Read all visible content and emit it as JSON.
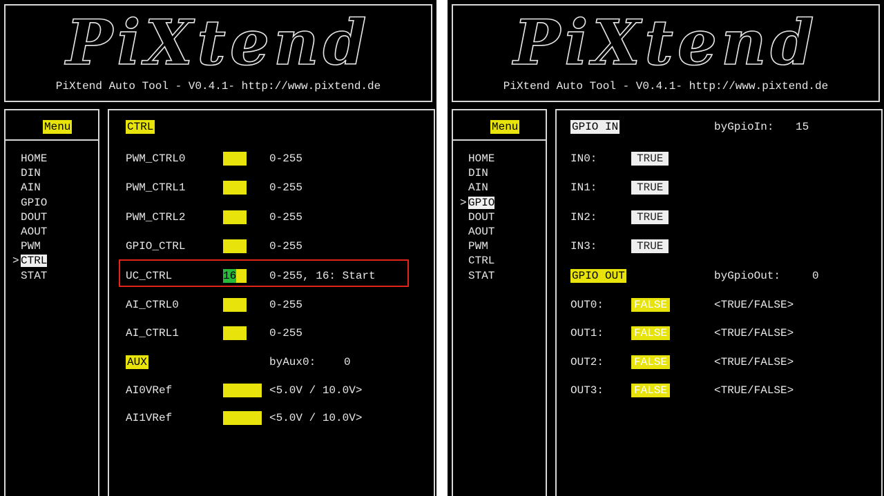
{
  "logo": {
    "text": "PiXtend",
    "subtitle": "PiXtend Auto Tool - V0.4.1- http://www.pixtend.de"
  },
  "menu": {
    "title": "Menu",
    "items": [
      "HOME",
      "DIN",
      "AIN",
      "GPIO",
      "DOUT",
      "AOUT",
      "PWM",
      "CTRL",
      "STAT"
    ],
    "cursor": ">"
  },
  "ctrl": {
    "title": "CTRL",
    "rows": [
      {
        "label": "PWM_CTRL0",
        "range": "0-255"
      },
      {
        "label": "PWM_CTRL1",
        "range": "0-255"
      },
      {
        "label": "PWM_CTRL2",
        "range": "0-255"
      },
      {
        "label": "GPIO_CTRL",
        "range": "0-255"
      },
      {
        "label": "UC_CTRL",
        "value": "16",
        "range": "0-255, 16: Start"
      },
      {
        "label": "AI_CTRL0",
        "range": "0-255"
      },
      {
        "label": "AI_CTRL1",
        "range": "0-255"
      }
    ],
    "aux_title": "AUX",
    "aux_value_label": "byAux0:",
    "aux_value": "0",
    "aux_rows": [
      {
        "label": "AI0VRef",
        "range": "<5.0V / 10.0V>"
      },
      {
        "label": "AI1VRef",
        "range": "<5.0V / 10.0V>"
      }
    ]
  },
  "gpio": {
    "in_title": "GPIO IN",
    "in_value_label": "byGpioIn:",
    "in_value": "15",
    "inputs": [
      {
        "label": "IN0:",
        "value": "TRUE"
      },
      {
        "label": "IN1:",
        "value": "TRUE"
      },
      {
        "label": "IN2:",
        "value": "TRUE"
      },
      {
        "label": "IN3:",
        "value": "TRUE"
      }
    ],
    "out_title": "GPIO OUT",
    "out_value_label": "byGpioOut:",
    "out_value": "0",
    "outputs": [
      {
        "label": "OUT0:",
        "value": "FALSE",
        "hint": "<TRUE/FALSE>"
      },
      {
        "label": "OUT1:",
        "value": "FALSE",
        "hint": "<TRUE/FALSE>"
      },
      {
        "label": "OUT2:",
        "value": "FALSE",
        "hint": "<TRUE/FALSE>"
      },
      {
        "label": "OUT3:",
        "value": "FALSE",
        "hint": "<TRUE/FALSE>"
      }
    ]
  },
  "colors": {
    "highlight": "#e8e40b",
    "selection": "#eeeeee",
    "cursor_green": "#28b83a",
    "annotation_red": "#e3241b"
  }
}
